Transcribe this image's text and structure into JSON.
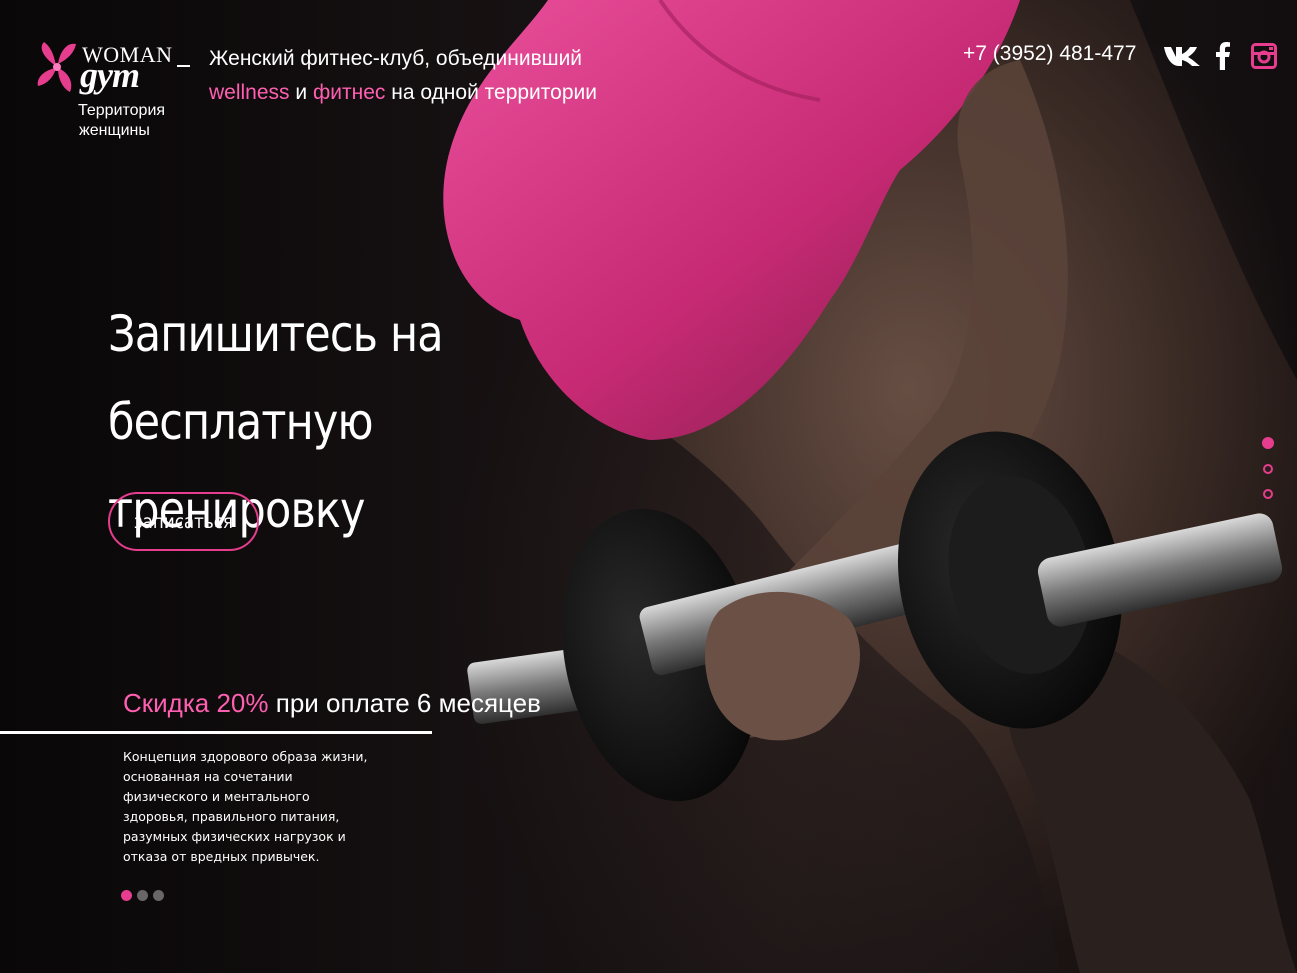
{
  "header": {
    "logo": {
      "brand_top": "WOMAN",
      "brand_main": "gym",
      "tagline_line1": "Территория",
      "tagline_line2": "женщины"
    },
    "tagline": {
      "line1": "Женский фитнес-клуб, объединивший",
      "word1": "wellness",
      "and": "и",
      "word2": "фитнес",
      "rest": "на одной территории"
    },
    "phone": "+7 (3952) 481-477",
    "social": [
      {
        "name": "vk",
        "icon": "vk-icon",
        "label": "VK"
      },
      {
        "name": "facebook",
        "icon": "facebook-icon",
        "label": "f"
      },
      {
        "name": "instagram",
        "icon": "instagram-icon"
      }
    ]
  },
  "hero": {
    "headline_line1": "Запишитесь на бесплатную",
    "headline_line2": "тренировку",
    "cta_label": "записаться",
    "slides_total": 3,
    "slide_active": 1
  },
  "promo": {
    "highlight": "Скидка 20%",
    "rest": "при оплате 6 месяцев",
    "description": "Концепция здорового образа жизни, основанная на сочетании физического и ментального здоровья, правильного питания, разумных физических нагрузок и отказа от вредных привычек.",
    "dots_total": 3,
    "dot_active": 1
  },
  "colors": {
    "accent": "#e63d8e",
    "accent_text": "#ff5fb0",
    "top_pink": "#d8307e",
    "background": "#0f0c0d"
  }
}
